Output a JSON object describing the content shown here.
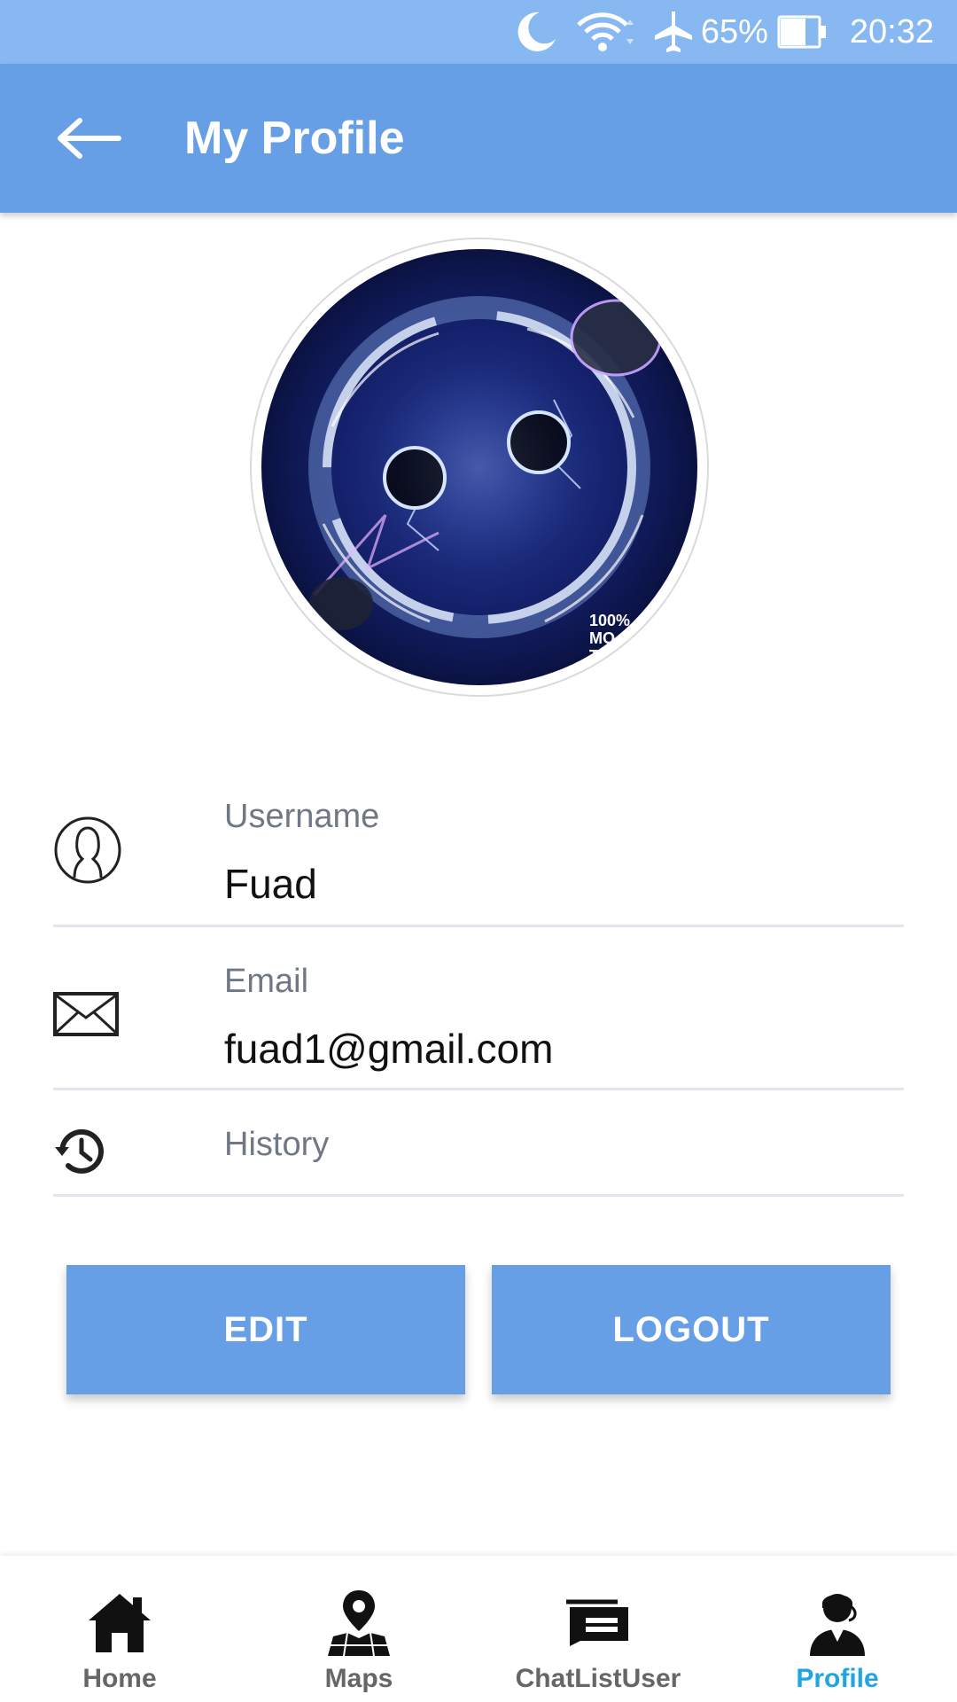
{
  "status_bar": {
    "battery_percent": "65%",
    "time": "20:32",
    "icons": [
      "moon-icon",
      "wifi-icon",
      "airplane-icon",
      "battery-icon"
    ]
  },
  "app_bar": {
    "title": "My Profile",
    "back_icon": "arrow-left-icon"
  },
  "profile": {
    "avatar_icon": "profile-picture",
    "fields": [
      {
        "icon": "user-icon",
        "label": "Username",
        "value": "Fuad"
      },
      {
        "icon": "mail-icon",
        "label": "Email",
        "value": "fuad1@gmail.com"
      },
      {
        "icon": "history-icon",
        "label": "History"
      }
    ]
  },
  "actions": {
    "edit_label": "EDIT",
    "logout_label": "LOGOUT"
  },
  "bottom_nav": {
    "items": [
      {
        "label": "Home",
        "icon": "home-icon"
      },
      {
        "label": "Maps",
        "icon": "map-pin-icon"
      },
      {
        "label": "ChatListUser",
        "icon": "chat-icon"
      },
      {
        "label": "Profile",
        "icon": "user-agent-icon",
        "active": true
      }
    ]
  },
  "colors": {
    "status_bar": "#88b8f2",
    "primary": "#669fe6",
    "active_tab": "#1fa5e0",
    "label_gray": "#707785"
  }
}
